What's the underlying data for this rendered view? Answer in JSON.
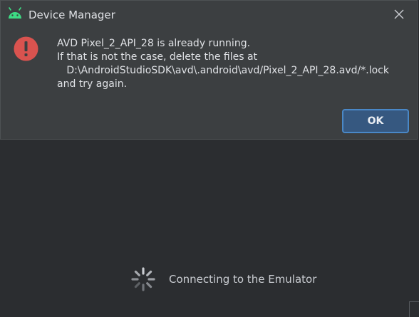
{
  "dialog": {
    "title": "Device Manager",
    "icon": "android-icon",
    "message_lines": [
      "AVD Pixel_2_API_28 is already running.",
      "If that is not the case, delete the files at",
      "   D:\\AndroidStudioSDK\\avd\\.android\\avd/Pixel_2_API_28.avd/*.lock",
      "and try again."
    ],
    "ok_label": "OK",
    "error_icon": "error-icon",
    "colors": {
      "error_red": "#d9534f",
      "android_green": "#3ddc84",
      "ok_button": "#365880"
    }
  },
  "background": {
    "status_text": "Connecting to the Emulator"
  }
}
